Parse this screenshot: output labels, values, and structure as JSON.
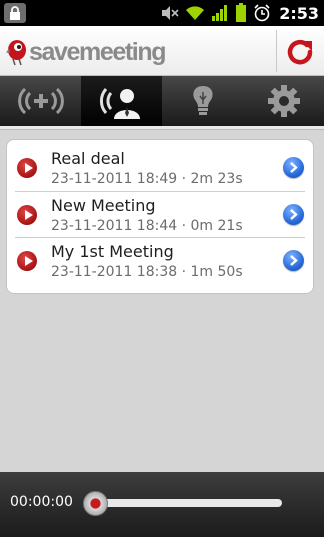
{
  "status_bar": {
    "time": "2:53",
    "icons": [
      "lock-icon",
      "mute-icon",
      "wifi-icon",
      "signal-icon",
      "battery-icon",
      "alarm-icon"
    ]
  },
  "title_bar": {
    "logo_text": "savemeeting",
    "refresh_icon": "refresh-icon"
  },
  "tabs": [
    {
      "icon": "add-meeting-icon",
      "active": false
    },
    {
      "icon": "meeting-speaker-icon",
      "active": true
    },
    {
      "icon": "ideas-bulb-icon",
      "active": false
    },
    {
      "icon": "settings-gear-icon",
      "active": false
    }
  ],
  "meetings": [
    {
      "title": "Real deal",
      "meta": "23-11-2011 18:49 · 2m 23s"
    },
    {
      "title": "New Meeting",
      "meta": "23-11-2011 18:44 · 0m 21s"
    },
    {
      "title": "My 1st Meeting",
      "meta": "23-11-2011 18:38 · 1m 50s"
    }
  ],
  "player": {
    "time": "00:00:00",
    "progress": 0
  },
  "colors": {
    "accent_red": "#b71c1c",
    "detail_blue": "#2366d8",
    "background": "#d5d5d5"
  }
}
